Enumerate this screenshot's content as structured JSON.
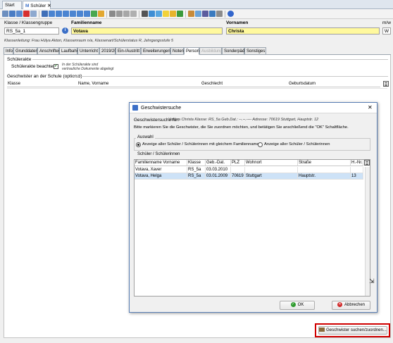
{
  "tabs": [
    {
      "label": "Start"
    },
    {
      "label": "Schüler",
      "close": "✕"
    }
  ],
  "header": {
    "klasse_label": "Klasse / Klassengruppe",
    "klasse_value": "RS_5a_1",
    "familienname_label": "Familienname",
    "familienname_value": "Votava",
    "vornamen_label": "Vornamen",
    "vornamen_value": "Christa",
    "mw_label": "m/w",
    "mw_value": "W",
    "info_line": "Klassenleitung: Frau Hülya Akton, Klassenraum n/a, Klassenart/Schülerstatus R, Jahrgangsstufe 5"
  },
  "module_tabs": [
    "Info",
    "Grunddaten",
    "Anschriften",
    "Laufbahn",
    "Unterricht",
    "2019/20",
    "Ein-/Austritt",
    "Erweiterungen",
    "Noten",
    "Person",
    "Ausbildung",
    "Sonderpäd.",
    "Sonstiges"
  ],
  "module_tab_active": "Person",
  "module_tab_disabled": "Ausbildung",
  "content": {
    "schuelerakte_title": "Schülerakte",
    "schuelerakte_label": "Schülerakte beachten",
    "schuelerakte_checked": "✓",
    "schuelerakte_note1": "In der Schülerakte sind",
    "schuelerakte_note2": "vertrauliche Dokumente abgelegt",
    "geschwister_title": "Geschwister an der Schule (optional)",
    "columns": [
      "Klasse",
      "Name, Vorname",
      "Geschlecht",
      "Geburtsdatum"
    ],
    "find_siblings_button": "Geschwister suchen/zuordnen..."
  },
  "dialog": {
    "title": "Geschwistersuche",
    "close": "✕",
    "search_for_label": "Geschwistersuche für:",
    "search_for_value": "Votava Christa Klasse: RS_5a Geb.Dat.: --.--.---- Adresse: 70619 Stuttgart, Hauptstr. 12",
    "instruction": "Bitte markieren Sie die Geschwister, die Sie zuordnen möchten, und betätigen Sie anschließend die \"OK\" Schaltfläche.",
    "auswahl_title": "Auswahl",
    "radio1": "Anzeige aller Schüler / Schülerinnen mit gleichem Familiennamen",
    "radio2": "Anzeige aller Schüler / Schülerinnen",
    "radio_selected": 1,
    "list_title": "Schüler / Schülerinnen",
    "columns": [
      "Familienname Vorname",
      "Klasse",
      "Geb.-Dat.",
      "PLZ",
      "Wohnort",
      "Straße",
      "H.-Nr."
    ],
    "rows": [
      {
        "name": "Votava, Xaver",
        "klasse": "RS_5a",
        "geb": "03.03.2010",
        "plz": "",
        "ort": "",
        "strasse": "",
        "hnr": ""
      },
      {
        "name": "Votava, Helga",
        "klasse": "RS_5a",
        "geb": "03.01.2009",
        "plz": "70619",
        "ort": "Stuttgart",
        "strasse": "Hauptstr.",
        "hnr": "13"
      }
    ],
    "selected_row": 1,
    "ok_label": "OK",
    "cancel_label": "Abbrechen"
  },
  "colors": {
    "highlight_yellow": "#fff99e",
    "selection_blue": "#cde2f7",
    "annotation_red": "#d00000",
    "dialog_border": "#5a7fb5"
  }
}
